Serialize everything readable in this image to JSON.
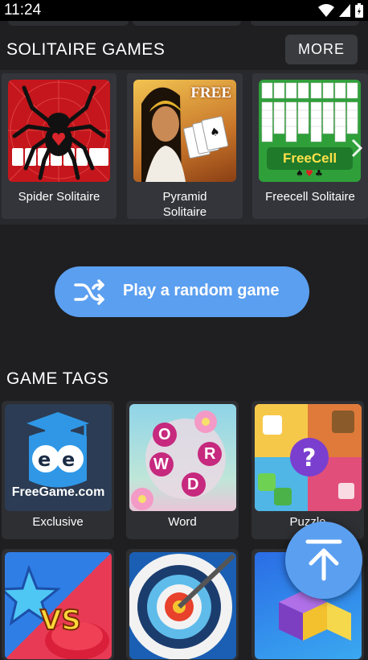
{
  "status_bar": {
    "time": "11:24"
  },
  "solitaire": {
    "title": "SOLITAIRE GAMES",
    "more_label": "MORE",
    "games": [
      {
        "line1": "Spider Solitaire",
        "line2": ""
      },
      {
        "line1": "Pyramid",
        "line2": "Solitaire",
        "badge": "FREE"
      },
      {
        "line1": "Freecell Solitaire",
        "line2": "",
        "badge": "FreeCell"
      }
    ]
  },
  "random_button": {
    "label": "Play a random game"
  },
  "game_tags": {
    "title": "GAME TAGS",
    "tags": [
      {
        "label": "Exclusive",
        "brand": "FreeGame.com"
      },
      {
        "label": "Word",
        "letters": [
          "W",
          "O",
          "R",
          "D"
        ]
      },
      {
        "label": "Puzzle"
      },
      {
        "label": ""
      },
      {
        "label": ""
      },
      {
        "label": ""
      }
    ]
  },
  "colors": {
    "accent": "#5b9ff0",
    "background": "#1f1f21",
    "card": "#33353a"
  }
}
